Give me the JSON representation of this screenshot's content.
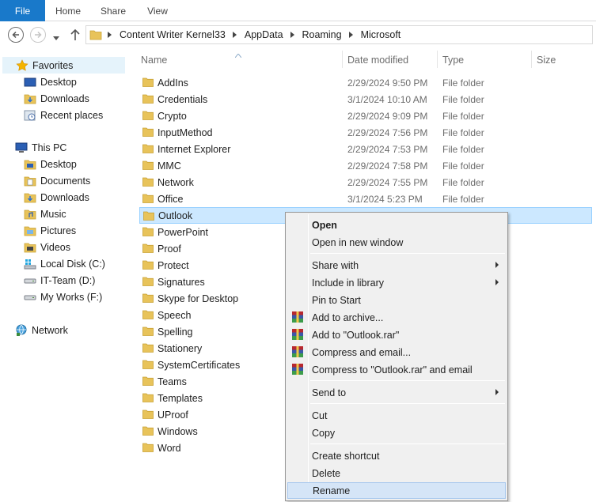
{
  "ribbon": {
    "tabs": [
      "File",
      "Home",
      "Share",
      "View"
    ]
  },
  "address": {
    "crumbs": [
      "Content Writer Kernel33",
      "AppData",
      "Roaming",
      "Microsoft"
    ]
  },
  "nav": {
    "favorites": {
      "label": "Favorites",
      "items": [
        "Desktop",
        "Downloads",
        "Recent places"
      ]
    },
    "this_pc": {
      "label": "This PC",
      "items": [
        "Desktop",
        "Documents",
        "Downloads",
        "Music",
        "Pictures",
        "Videos",
        "Local Disk (C:)",
        "IT-Team (D:)",
        "My Works (F:)"
      ]
    },
    "network": {
      "label": "Network"
    }
  },
  "columns": {
    "name": "Name",
    "date": "Date modified",
    "type": "Type",
    "size": "Size"
  },
  "files": [
    {
      "name": "AddIns",
      "date": "2/29/2024 9:50 PM",
      "type": "File folder"
    },
    {
      "name": "Credentials",
      "date": "3/1/2024 10:10 AM",
      "type": "File folder"
    },
    {
      "name": "Crypto",
      "date": "2/29/2024 9:09 PM",
      "type": "File folder"
    },
    {
      "name": "InputMethod",
      "date": "2/29/2024 7:56 PM",
      "type": "File folder"
    },
    {
      "name": "Internet Explorer",
      "date": "2/29/2024 7:53 PM",
      "type": "File folder"
    },
    {
      "name": "MMC",
      "date": "2/29/2024 7:58 PM",
      "type": "File folder"
    },
    {
      "name": "Network",
      "date": "2/29/2024 7:55 PM",
      "type": "File folder"
    },
    {
      "name": "Office",
      "date": "3/1/2024 5:23 PM",
      "type": "File folder"
    },
    {
      "name": "Outlook",
      "date": "",
      "type": "",
      "selected": true
    },
    {
      "name": "PowerPoint",
      "date": "",
      "type": ""
    },
    {
      "name": "Proof",
      "date": "",
      "type": ""
    },
    {
      "name": "Protect",
      "date": "",
      "type": ""
    },
    {
      "name": "Signatures",
      "date": "",
      "type": ""
    },
    {
      "name": "Skype for Desktop",
      "date": "",
      "type": ""
    },
    {
      "name": "Speech",
      "date": "",
      "type": ""
    },
    {
      "name": "Spelling",
      "date": "",
      "type": ""
    },
    {
      "name": "Stationery",
      "date": "",
      "type": ""
    },
    {
      "name": "SystemCertificates",
      "date": "",
      "type": ""
    },
    {
      "name": "Teams",
      "date": "",
      "type": ""
    },
    {
      "name": "Templates",
      "date": "",
      "type": ""
    },
    {
      "name": "UProof",
      "date": "",
      "type": ""
    },
    {
      "name": "Windows",
      "date": "",
      "type": ""
    },
    {
      "name": "Word",
      "date": "",
      "type": ""
    }
  ],
  "context_menu": {
    "open": "Open",
    "open_new_window": "Open in new window",
    "share_with": "Share with",
    "include_in_library": "Include in library",
    "pin_to_start": "Pin to Start",
    "add_to_archive": "Add to archive...",
    "add_to_rar": "Add to \"Outlook.rar\"",
    "compress_email": "Compress and email...",
    "compress_rar_email": "Compress to \"Outlook.rar\" and email",
    "send_to": "Send to",
    "cut": "Cut",
    "copy": "Copy",
    "create_shortcut": "Create shortcut",
    "delete": "Delete",
    "rename": "Rename"
  },
  "colors": {
    "file_tab": "#1979ca",
    "selection": "#cce8ff",
    "folder": "#e8c35a",
    "menu_highlight": "#d5e5f7"
  }
}
